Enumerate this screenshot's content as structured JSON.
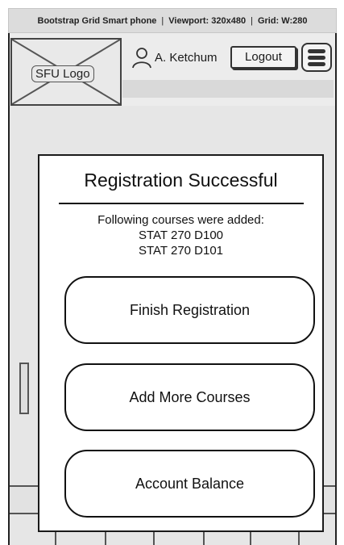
{
  "caption": {
    "title": "Bootstrap Grid Smart phone",
    "separator": "|",
    "viewport": "Viewport: 320x480",
    "grid": "Grid: W:280"
  },
  "header": {
    "logo_label": "SFU Logo",
    "user_name": "A. Ketchum",
    "logout_label": "Logout"
  },
  "modal": {
    "title": "Registration Successful",
    "message": "Following courses were added:",
    "courses": [
      "STAT 270 D100",
      "STAT 270 D101"
    ],
    "buttons": {
      "finish": "Finish Registration",
      "add_more": "Add More Courses",
      "balance": "Account Balance"
    }
  },
  "icons": {
    "user": "user-icon",
    "menu": "hamburger-menu-icon"
  }
}
